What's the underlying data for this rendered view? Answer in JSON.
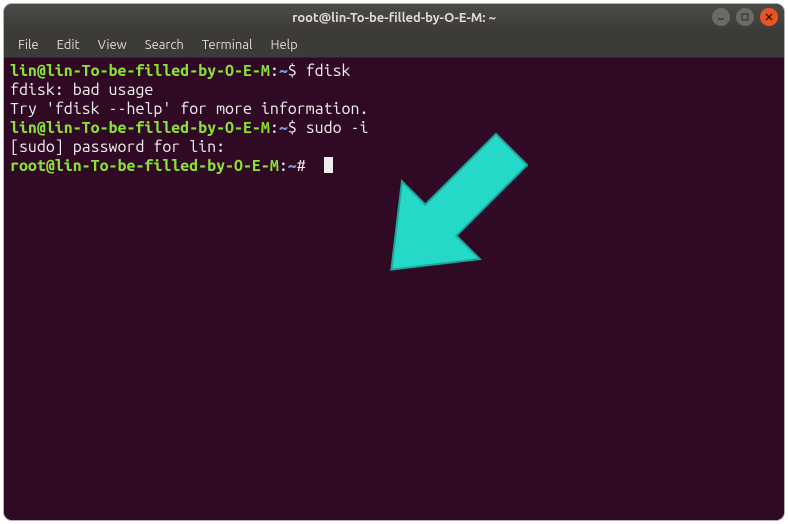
{
  "window": {
    "title": "root@lin-To-be-filled-by-O-E-M: ~"
  },
  "menubar": {
    "items": [
      "File",
      "Edit",
      "View",
      "Search",
      "Terminal",
      "Help"
    ]
  },
  "terminal": {
    "lines": [
      {
        "type": "user_prompt",
        "user": "lin@lin-To-be-filled-by-O-E-M",
        "path": "~",
        "sigil": "$",
        "cmd": "fdisk"
      },
      {
        "type": "output",
        "text": "fdisk: bad usage"
      },
      {
        "type": "output",
        "text": "Try 'fdisk --help' for more information."
      },
      {
        "type": "user_prompt",
        "user": "lin@lin-To-be-filled-by-O-E-M",
        "path": "~",
        "sigil": "$",
        "cmd": "sudo -i"
      },
      {
        "type": "output",
        "text": "[sudo] password for lin:"
      },
      {
        "type": "root_prompt",
        "user": "root@lin-To-be-filled-by-O-E-M",
        "path": "~",
        "sigil": "#",
        "cmd": "",
        "cursor": true
      }
    ]
  },
  "annotation": {
    "arrow_color": "#25d9c9"
  }
}
